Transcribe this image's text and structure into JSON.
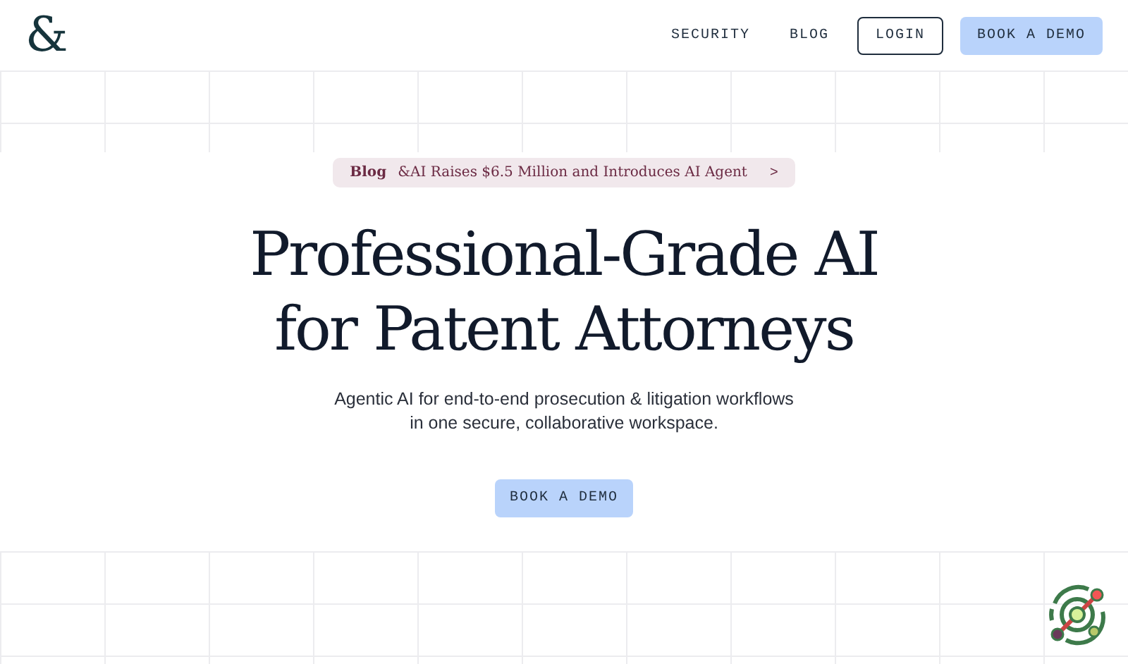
{
  "logo": "&",
  "nav": [
    {
      "label": "SECURITY",
      "kind": "link"
    },
    {
      "label": "BLOG",
      "kind": "link"
    },
    {
      "label": "LOGIN",
      "kind": "outline"
    },
    {
      "label": "BOOK A DEMO",
      "kind": "primary"
    }
  ],
  "announcement": {
    "tag": "Blog",
    "text": "&AI Raises $6.5 Million and Introduces AI Agent",
    "arrow": ">"
  },
  "hero": {
    "title_lines": [
      "Professional-Grade AI",
      "for Patent Attorneys"
    ],
    "subtitle_lines": [
      "Agentic AI for end-to-end prosecution & litigation workflows",
      "in one secure, collaborative workspace."
    ],
    "cta": "BOOK A DEMO"
  }
}
